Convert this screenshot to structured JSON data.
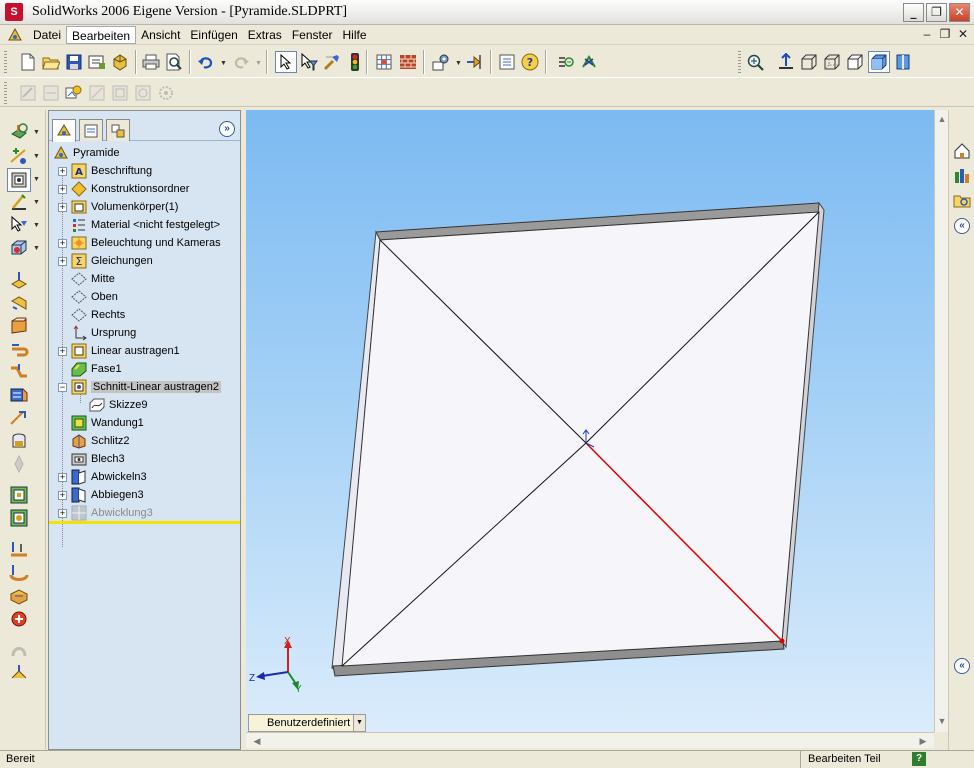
{
  "window": {
    "title": "SolidWorks 2006 Eigene Version - [Pyramide.SLDPRT]",
    "buttons": {
      "minimize": "_",
      "restore": "❐",
      "close": "✕"
    }
  },
  "menubar": {
    "items": [
      {
        "label": "Datei"
      },
      {
        "label": "Bearbeiten"
      },
      {
        "label": "Ansicht"
      },
      {
        "label": "Einfügen"
      },
      {
        "label": "Extras"
      },
      {
        "label": "Fenster"
      },
      {
        "label": "Hilfe"
      }
    ],
    "active_index": 1,
    "doc_buttons": {
      "minimize": "–",
      "restore": "❐",
      "close": "✕"
    }
  },
  "feature_manager": {
    "tabs": [
      "feature-manager-tab",
      "property-manager-tab",
      "configuration-manager-tab"
    ],
    "expand_label": "»",
    "tree": [
      {
        "label": "Pyramide",
        "icon": "part-icon",
        "level": 0
      },
      {
        "label": "Beschriftung",
        "icon": "annotation-icon",
        "level": 1,
        "expander": "+"
      },
      {
        "label": "Konstruktionsordner",
        "icon": "design-binder-icon",
        "level": 1,
        "expander": "+"
      },
      {
        "label": "Volumenkörper(1)",
        "icon": "solid-bodies-icon",
        "level": 1,
        "expander": "+"
      },
      {
        "label": "Material <nicht festgelegt>",
        "icon": "material-icon",
        "level": 1
      },
      {
        "label": "Beleuchtung und Kameras",
        "icon": "lights-icon",
        "level": 1,
        "expander": "+"
      },
      {
        "label": "Gleichungen",
        "icon": "equations-icon",
        "level": 1,
        "expander": "+"
      },
      {
        "label": "Mitte",
        "icon": "plane-icon",
        "level": 1
      },
      {
        "label": "Oben",
        "icon": "plane-icon",
        "level": 1
      },
      {
        "label": "Rechts",
        "icon": "plane-icon",
        "level": 1
      },
      {
        "label": "Ursprung",
        "icon": "origin-icon",
        "level": 1
      },
      {
        "label": "Linear austragen1",
        "icon": "extrude-icon",
        "level": 1,
        "expander": "+"
      },
      {
        "label": "Fase1",
        "icon": "chamfer-icon",
        "level": 1
      },
      {
        "label": "Schnitt-Linear austragen2",
        "icon": "cut-extrude-icon",
        "level": 1,
        "expander": "−",
        "selected": true
      },
      {
        "label": "Skizze9",
        "icon": "sketch-icon",
        "level": 2
      },
      {
        "label": "Wandung1",
        "icon": "shell-icon",
        "level": 1
      },
      {
        "label": "Schlitz2",
        "icon": "rip-icon",
        "level": 1
      },
      {
        "label": "Blech3",
        "icon": "sheet-metal-icon",
        "level": 1
      },
      {
        "label": "Abwickeln3",
        "icon": "unfold-icon",
        "level": 1,
        "expander": "+"
      },
      {
        "label": "Abbiegen3",
        "icon": "fold-icon",
        "level": 1,
        "expander": "+"
      },
      {
        "label": "Abwicklung3",
        "icon": "flat-pattern-icon",
        "level": 1,
        "expander": "+",
        "dim": true
      }
    ]
  },
  "viewport": {
    "configuration_tab": "Benutzerdefiniert",
    "triad": {
      "x_label": "X",
      "y_label": "Y",
      "z_label": "Z"
    }
  },
  "statusbar": {
    "left": "Bereit",
    "mode": "Bearbeiten Teil",
    "help": "?"
  },
  "colors": {
    "viewport_top": "#7cbaf2",
    "viewport_bottom": "#dbecfb",
    "panel_bg": "#d7e4f2",
    "rollback_bar": "#f2e400",
    "highlight_edge": "#e00000"
  }
}
